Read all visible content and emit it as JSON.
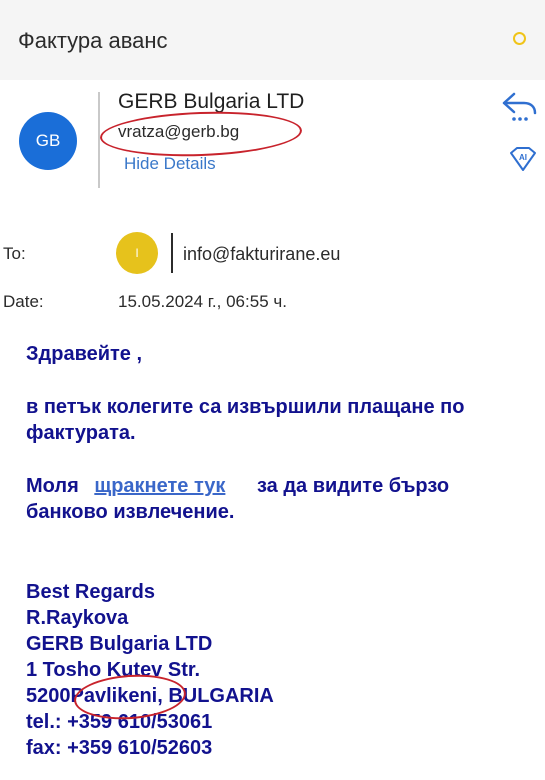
{
  "header": {
    "subject": "Фактура аванс"
  },
  "sender": {
    "avatar_initials": "GB",
    "name": "GERB Bulgaria LTD",
    "email": "vratza@gerb.bg",
    "hide_details": "Hide Details"
  },
  "recipient": {
    "label": "To:",
    "avatar_initial": "I",
    "email": "info@fakturirane.eu"
  },
  "date": {
    "label": "Date:",
    "value": "15.05.2024 г., 06:55 ч."
  },
  "message": {
    "greeting": "Здравейте ,",
    "line1": "в петък колегите са извършили плащане по",
    "line2": "фактурата.",
    "please": "Моля",
    "link_text": "щракнете тук",
    "line3_rest": "за да видите бързо",
    "line4": "банково извлечение.",
    "signature": {
      "regards": "Best Regards",
      "person": "R.Raykova",
      "company": "GERB Bulgaria LTD",
      "street": "1 Tosho Kutev Str.",
      "postcode": "5200",
      "town": "Pavlikeni",
      "country": ", BULGARIA",
      "tel": "tel.: +359 610/53061",
      "fax": "fax: +359 610/52603"
    }
  },
  "icons": {
    "reply": "reply-icon",
    "more": "more-dots-icon",
    "ai": "ai-icon",
    "flag": "flag-icon"
  },
  "colors": {
    "accent": "#1a6ed8",
    "message_text": "#12128e",
    "annotation": "#c8232c",
    "link": "#3a67c9"
  }
}
